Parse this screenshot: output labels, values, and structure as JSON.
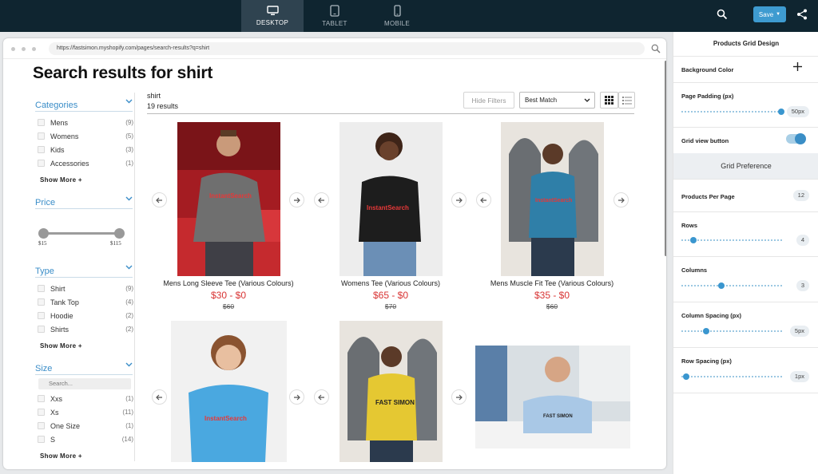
{
  "topbar": {
    "tabs": [
      {
        "label": "DESKTOP",
        "icon": "desktop-icon",
        "active": true
      },
      {
        "label": "TABLET",
        "icon": "tablet-icon",
        "active": false
      },
      {
        "label": "MOBILE",
        "icon": "mobile-icon",
        "active": false
      }
    ],
    "save_label": "Save",
    "accent": "#3e9bd0"
  },
  "browser": {
    "url": "https://fastsimon.myshopify.com/pages/search-results?q=shirt"
  },
  "page": {
    "title": "Search results for shirt",
    "query": "shirt",
    "result_count": "19 results",
    "hide_filters": "Hide Filters",
    "sort_value": "Best Match"
  },
  "filters": {
    "categories": {
      "title": "Categories",
      "items": [
        {
          "name": "Mens",
          "count": "(9)"
        },
        {
          "name": "Womens",
          "count": "(5)"
        },
        {
          "name": "Kids",
          "count": "(3)"
        },
        {
          "name": "Accessories",
          "count": "(1)"
        }
      ],
      "show_more": "Show More +"
    },
    "price": {
      "title": "Price",
      "min_label": "$15",
      "max_label": "$115"
    },
    "type": {
      "title": "Type",
      "items": [
        {
          "name": "Shirt",
          "count": "(9)"
        },
        {
          "name": "Tank Top",
          "count": "(4)"
        },
        {
          "name": "Hoodie",
          "count": "(2)"
        },
        {
          "name": "Shirts",
          "count": "(2)"
        }
      ],
      "show_more": "Show More +"
    },
    "size": {
      "title": "Size",
      "search_placeholder": "Search...",
      "items": [
        {
          "name": "Xxs",
          "count": "(1)"
        },
        {
          "name": "Xs",
          "count": "(11)"
        },
        {
          "name": "One Size",
          "count": "(1)"
        },
        {
          "name": "S",
          "count": "(14)"
        }
      ],
      "show_more": "Show More +"
    }
  },
  "products": [
    {
      "name": "Mens Long Sleeve Tee (Various Colours)",
      "price": "$30 - $0",
      "old_price": "$60",
      "shirt_color": "#6f6f6f",
      "logo": "InstantSearch"
    },
    {
      "name": "Womens Tee (Various Colours)",
      "price": "$65 - $0",
      "old_price": "$70",
      "shirt_color": "#1d1d1d",
      "logo": "InstantSearch"
    },
    {
      "name": "Mens Muscle Fit Tee (Various Colours)",
      "price": "$35 - $0",
      "old_price": "$60",
      "shirt_color": "#2f7fa8",
      "logo": "InstantSearch"
    },
    {
      "shirt_color": "#4aa8e0",
      "logo": "InstantSearch"
    },
    {
      "shirt_color": "#e5c832",
      "logo": "FAST SIMON"
    },
    {
      "shirt_color": "#a9c8e6",
      "logo": "FAST SIMON"
    }
  ],
  "panel": {
    "title": "Products Grid Design",
    "background_color": "Background Color",
    "page_padding": {
      "label": "Page Padding (px)",
      "value": "50px"
    },
    "grid_view_button": {
      "label": "Grid view button",
      "enabled": true
    },
    "grid_preference": "Grid Preference",
    "products_per_page": {
      "label": "Products Per Page",
      "value": "12"
    },
    "rows": {
      "label": "Rows",
      "value": "4"
    },
    "columns": {
      "label": "Columns",
      "value": "3"
    },
    "column_spacing": {
      "label": "Column Spacing (px)",
      "value": "5px"
    },
    "row_spacing": {
      "label": "Row Spacing (px)",
      "value": "1px"
    }
  }
}
